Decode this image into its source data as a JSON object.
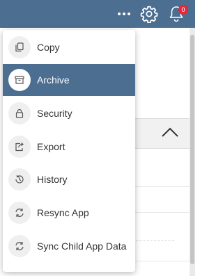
{
  "colors": {
    "topbar": "#4b6e91",
    "active_item": "#4b6e91",
    "badge": "#e5283a"
  },
  "header": {
    "more_icon": "more-horizontal-icon",
    "settings_icon": "gear-icon",
    "notifications_icon": "bell-icon",
    "notification_count": "0"
  },
  "menu": {
    "items": [
      {
        "label": "Copy",
        "icon": "copy-icon",
        "active": false
      },
      {
        "label": "Archive",
        "icon": "archive-icon",
        "active": true
      },
      {
        "label": "Security",
        "icon": "lock-icon",
        "active": false
      },
      {
        "label": "Export",
        "icon": "export-icon",
        "active": false
      },
      {
        "label": "History",
        "icon": "history-icon",
        "active": false
      },
      {
        "label": "Resync App",
        "icon": "sync-icon",
        "active": false
      },
      {
        "label": "Sync Child App Data",
        "icon": "sync-icon",
        "active": false
      }
    ]
  }
}
